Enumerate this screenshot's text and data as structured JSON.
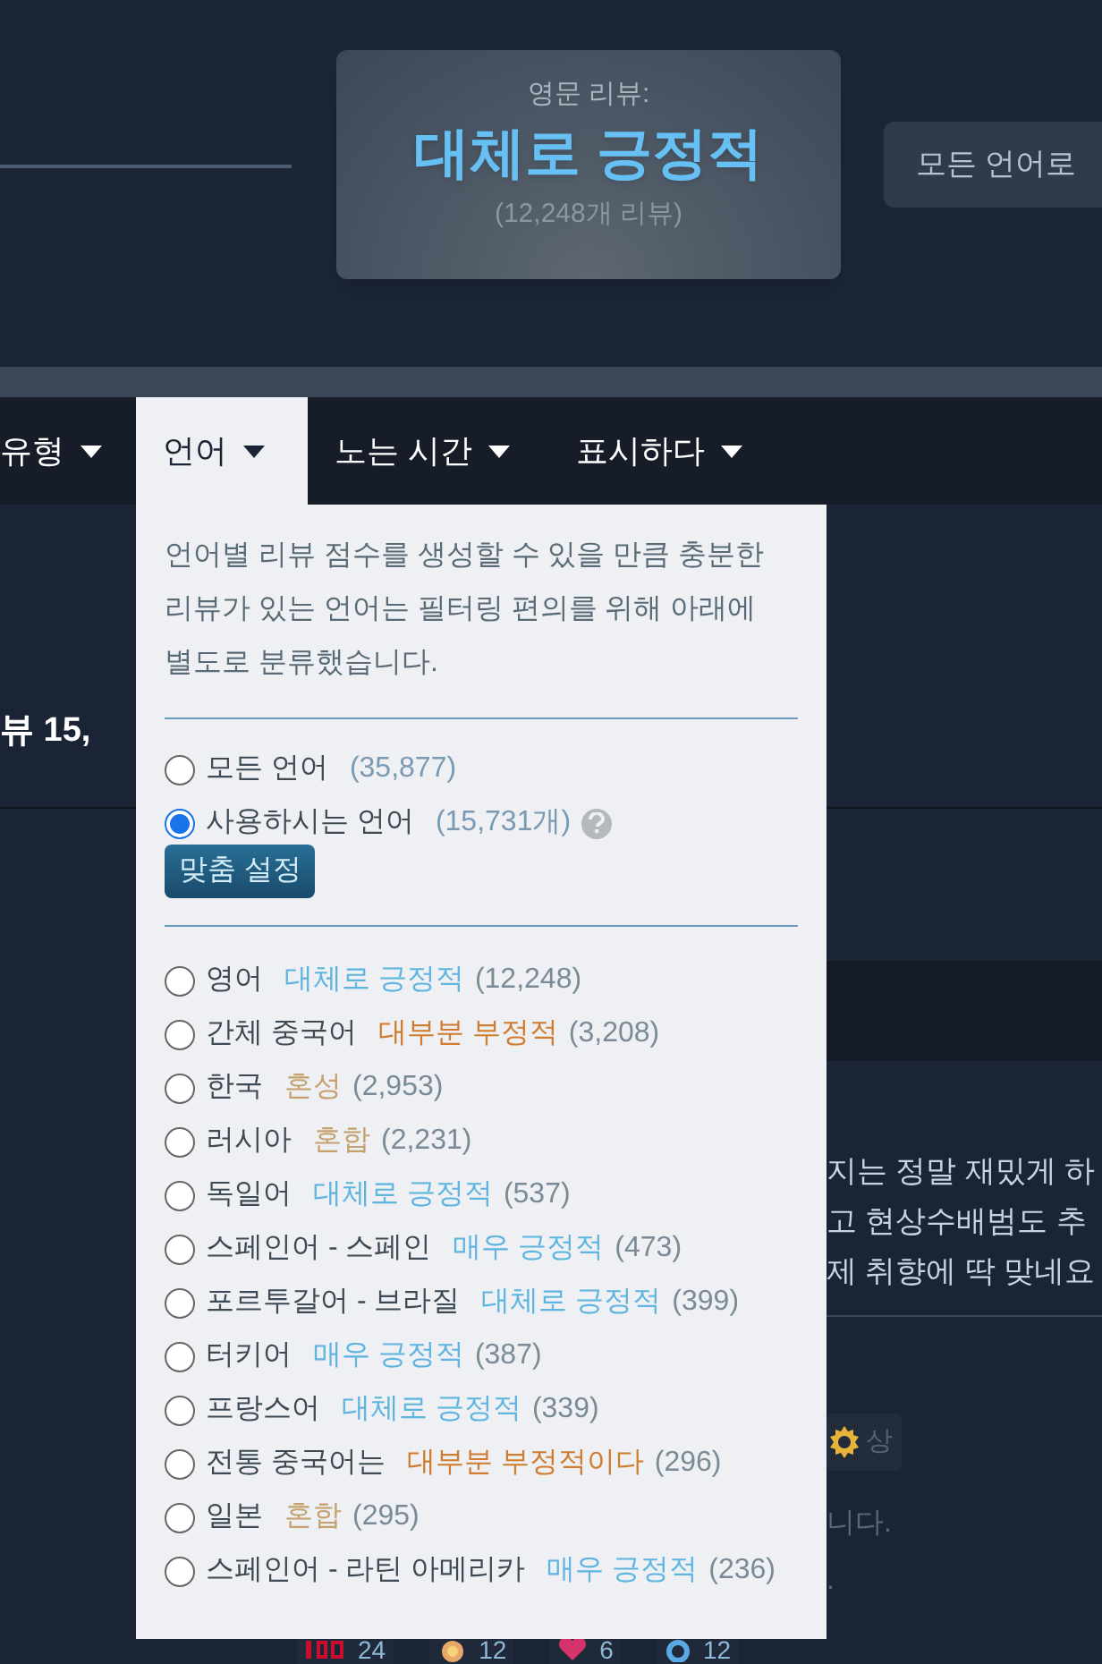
{
  "summary": {
    "label": "영문 리뷰:",
    "rating": "대체로 긍정적",
    "count": "(12,248개 리뷰)"
  },
  "all_languages_button": "모든 언어로",
  "filter_tabs": [
    {
      "label": "유형",
      "selected": false
    },
    {
      "label": "언어",
      "selected": true
    },
    {
      "label": "노는 시간",
      "selected": false
    },
    {
      "label": "표시하다",
      "selected": false
    }
  ],
  "language_menu": {
    "description_lines": [
      "언어별 리뷰 점수를 생성할 수 있을 만큼 충분한",
      "리뷰가 있는 언어는 필터링 편의를 위해 아래에",
      "별도로 분류했습니다."
    ],
    "scope_options": [
      {
        "label": "모든 언어",
        "count": "(35,877)",
        "selected": false,
        "help": false
      },
      {
        "label": "사용하시는 언어",
        "count": "(15,731개)",
        "selected": true,
        "help": true
      }
    ],
    "customize_button": "맞춤 설정",
    "languages": [
      {
        "name": "영어",
        "rating": "대체로 긍정적",
        "color": "#5fb4e0",
        "count": "(12,248)",
        "selected": false
      },
      {
        "name": "간체 중국어",
        "rating": "대부분 부정적",
        "color": "#d07c2e",
        "count": "(3,208)",
        "selected": false
      },
      {
        "name": "한국",
        "rating": "혼성",
        "color": "#c4a16e",
        "count": "(2,953)",
        "selected": false
      },
      {
        "name": "러시아",
        "rating": "혼합",
        "color": "#c4a16e",
        "count": "(2,231)",
        "selected": false
      },
      {
        "name": "독일어",
        "rating": "대체로 긍정적",
        "color": "#5fb4e0",
        "count": "(537)",
        "selected": false
      },
      {
        "name": "스페인어 - 스페인",
        "rating": "매우 긍정적",
        "color": "#5fb4e0",
        "count": "(473)",
        "selected": false
      },
      {
        "name": "포르투갈어 - 브라질",
        "rating": "대체로 긍정적",
        "color": "#5fb4e0",
        "count": "(399)",
        "selected": false
      },
      {
        "name": "터키어",
        "rating": "매우 긍정적",
        "color": "#5fb4e0",
        "count": "(387)",
        "selected": false
      },
      {
        "name": "프랑스어",
        "rating": "대체로 긍정적",
        "color": "#5fb4e0",
        "count": "(339)",
        "selected": false
      },
      {
        "name": "전통 중국어는",
        "rating": "대부분 부정적이다",
        "color": "#d07c2e",
        "count": "(296)",
        "selected": false
      },
      {
        "name": "일본",
        "rating": "혼합",
        "color": "#c4a16e",
        "count": "(295)",
        "selected": false
      },
      {
        "name": "스페인어 - 라틴 아메리카",
        "rating": "매우 긍정적",
        "color": "#5fb4e0",
        "count": "(236)",
        "selected": false
      }
    ]
  },
  "background": {
    "review_total": "뷰 15,",
    "review_text_lines": [
      "지는 정말 재밌게 하",
      "고 현상수배범도 추",
      "제 취향에 딱 맞네요"
    ],
    "helpful_button": "상",
    "trailing_texts": [
      "니다.",
      "."
    ],
    "awards": [
      {
        "kind": "hundred",
        "count": "24"
      },
      {
        "kind": "sun",
        "count": "12"
      },
      {
        "kind": "heart",
        "count": "6"
      },
      {
        "kind": "ring",
        "count": "12"
      }
    ]
  }
}
